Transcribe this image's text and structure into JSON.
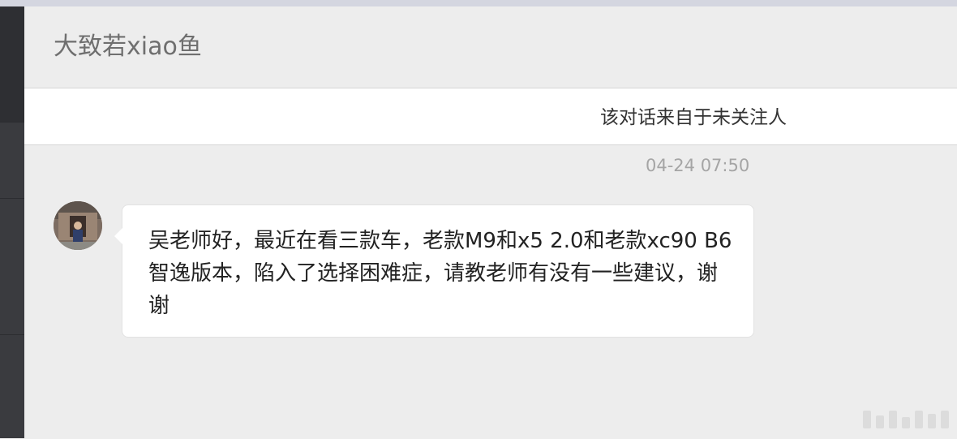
{
  "header": {
    "contact_name": "大致若xiao鱼"
  },
  "notice": {
    "text": "该对话来自于未关注人"
  },
  "messages": [
    {
      "timestamp": "04-24 07:50",
      "avatar_icon": "user-avatar",
      "text": "吴老师好，最近在看三款车，老款M9和x5 2.0和老款xc90 B6智逸版本，陷入了选择困难症，请教老师有没有一些建议，谢谢"
    }
  ],
  "colors": {
    "background": "#ededed",
    "bubble": "#ffffff",
    "left_rail": "#3a3b3f",
    "header_text": "#6f6f6f",
    "timestamp_text": "#a5a5a5"
  }
}
